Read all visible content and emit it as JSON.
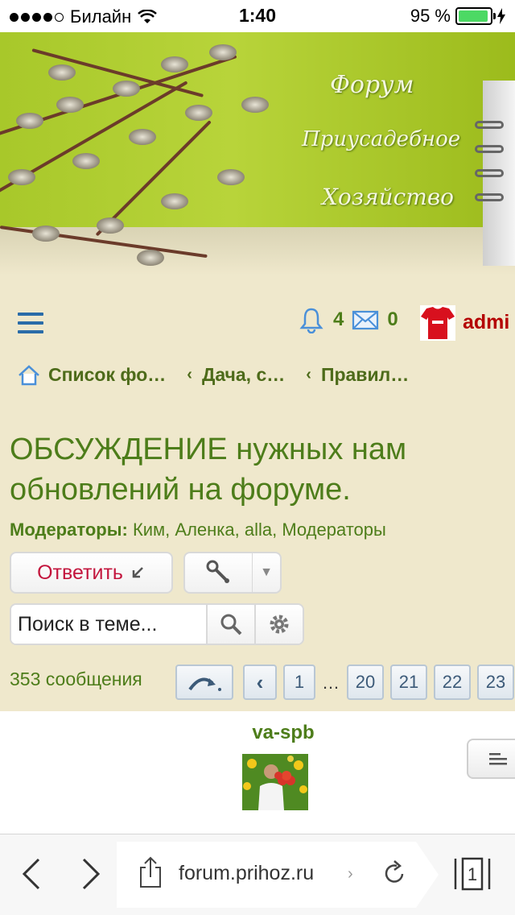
{
  "status_bar": {
    "carrier": "Билайн",
    "time": "1:40",
    "battery_percent": "95 %",
    "battery_level": 0.95
  },
  "banner": {
    "line1": "Форум",
    "line2": "Приусадебное",
    "line3": "Хозяйство"
  },
  "header": {
    "alerts_count": "4",
    "messages_count": "0",
    "username": "admi"
  },
  "breadcrumb": [
    {
      "label": "Список фо…"
    },
    {
      "label": "Дача, с…"
    },
    {
      "label": "Правил…"
    }
  ],
  "thread": {
    "title": "ОБСУЖДЕНИЕ нужных нам обновлений на форуме.",
    "moderators_label": "Модераторы:",
    "moderators": "Ким, Аленка, alla, Модераторы"
  },
  "actions": {
    "reply_label": "Ответить",
    "search_placeholder": "Поиск в теме..."
  },
  "pagination": {
    "message_count": "353 сообщения",
    "pages": [
      "1",
      "…",
      "20",
      "21",
      "22",
      "23"
    ]
  },
  "post": {
    "author": "va-spb"
  },
  "browser": {
    "url": "forum.prihoz.ru",
    "url_suffix": "›",
    "tabs_count": "1"
  },
  "colors": {
    "page_bg": "#efe8cc",
    "forum_green": "#4d7d1a",
    "reply_red": "#c3153d",
    "username_red": "#b40000",
    "link_blue": "#2a6ca8"
  }
}
